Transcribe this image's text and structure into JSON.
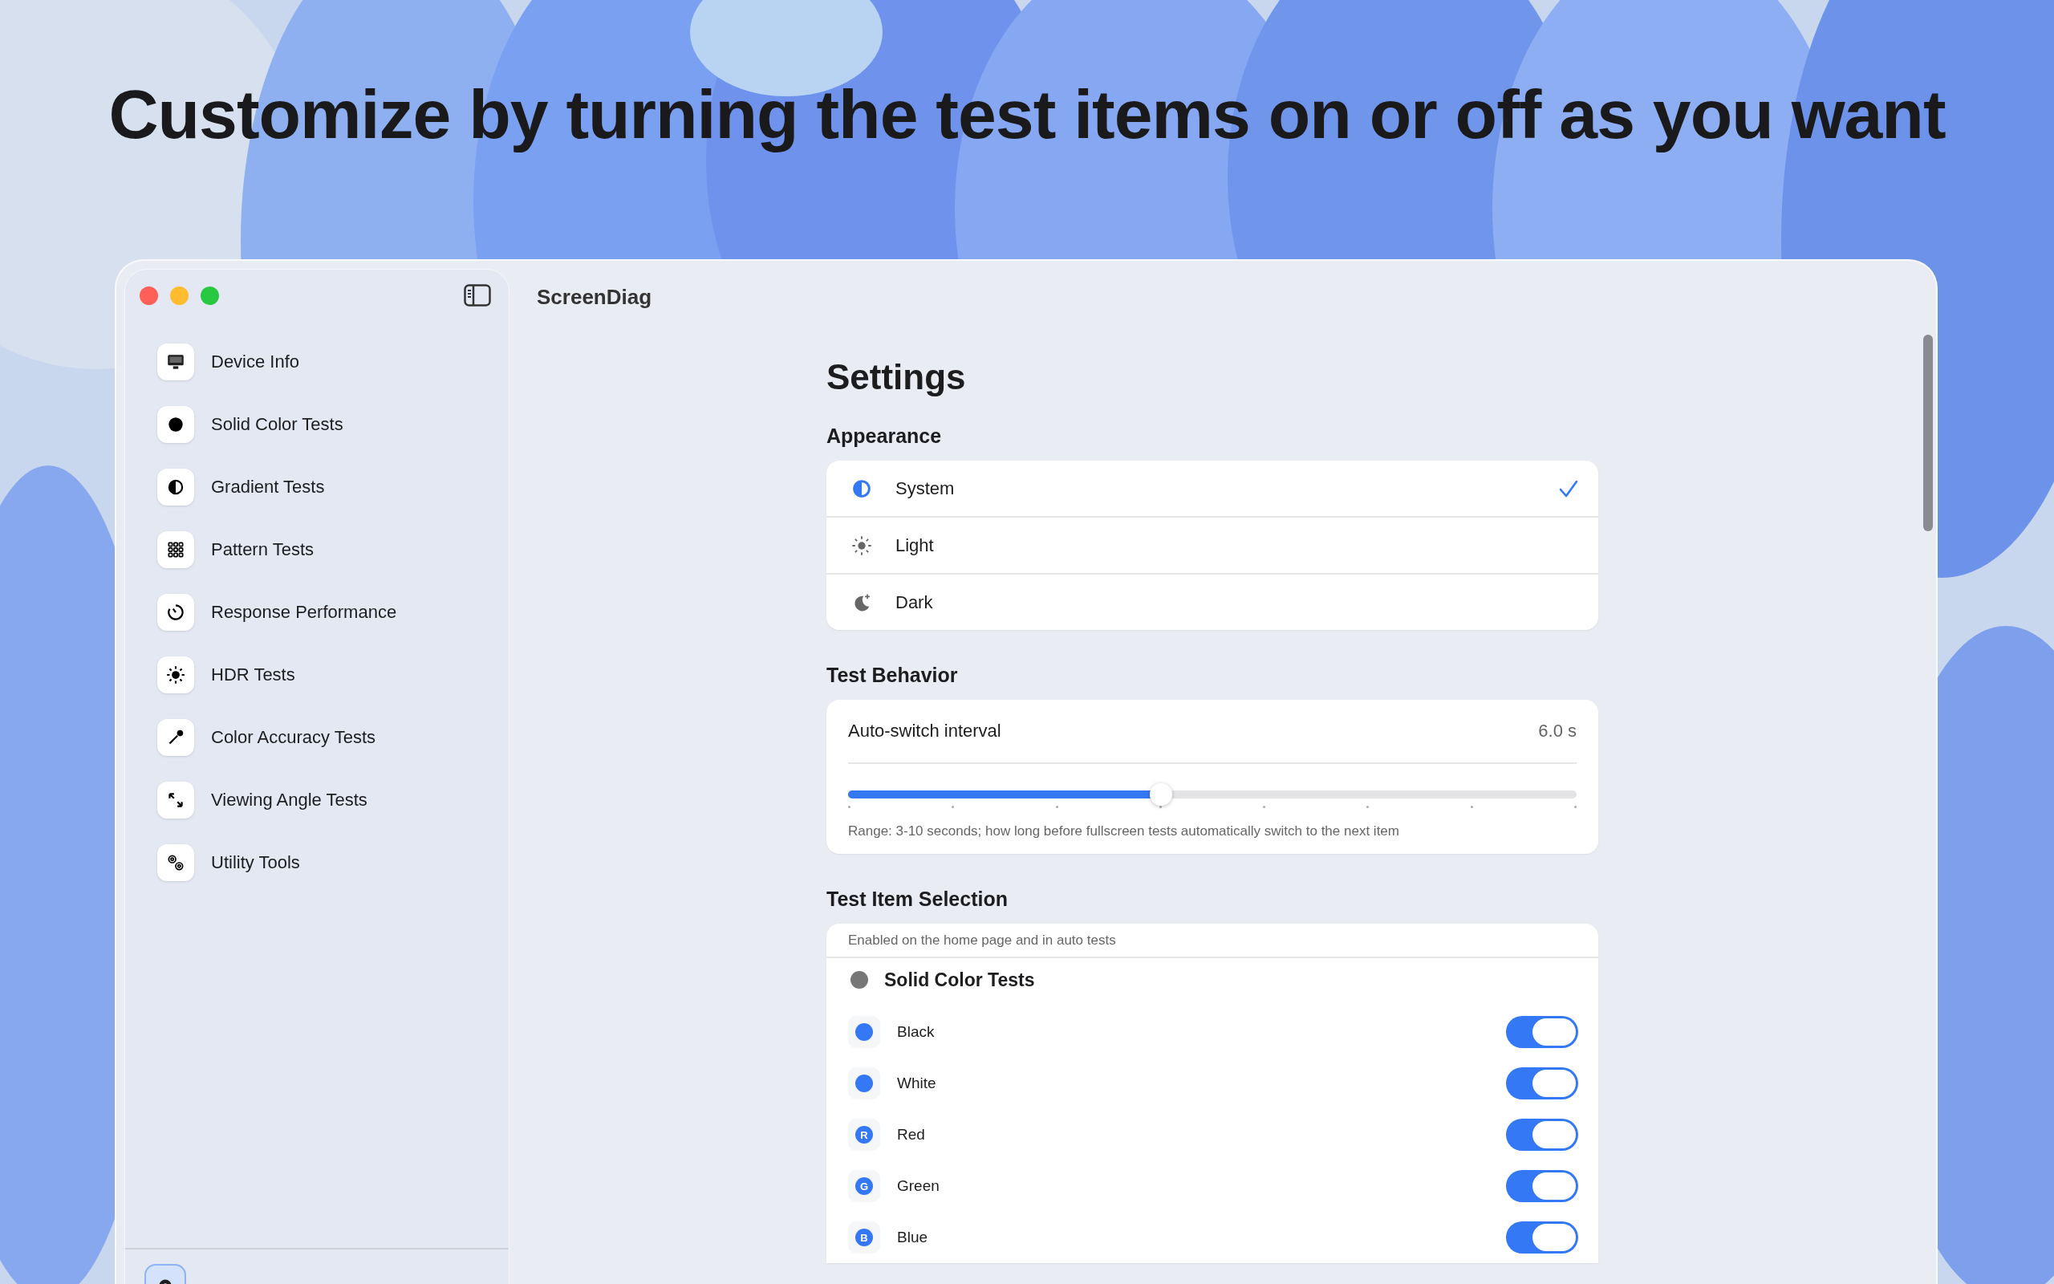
{
  "headline": "Customize by turning the test items on or off as you want",
  "window": {
    "title": "ScreenDiag"
  },
  "sidebar": {
    "items": [
      {
        "label": "Device Info",
        "selected": false
      },
      {
        "label": "Solid Color Tests",
        "selected": false
      },
      {
        "label": "Gradient Tests",
        "selected": false
      },
      {
        "label": "Pattern Tests",
        "selected": false
      },
      {
        "label": "Response Performance",
        "selected": false
      },
      {
        "label": "HDR Tests",
        "selected": false
      },
      {
        "label": "Color Accuracy Tests",
        "selected": false
      },
      {
        "label": "Viewing Angle Tests",
        "selected": false
      },
      {
        "label": "Utility Tools",
        "selected": false
      }
    ],
    "footer_item": {
      "selected": true
    }
  },
  "settings": {
    "title": "Settings",
    "appearance": {
      "heading": "Appearance",
      "options": [
        {
          "label": "System",
          "selected": true
        },
        {
          "label": "Light",
          "selected": false
        },
        {
          "label": "Dark",
          "selected": false
        }
      ]
    },
    "test_behavior": {
      "heading": "Test Behavior",
      "label": "Auto-switch interval",
      "reading": "6.0 s",
      "level": 0.43,
      "hint": "Range: 3-10 seconds; how long before fullscreen tests automatically switch to the next item"
    },
    "test_item_selection": {
      "heading": "Test Item Selection",
      "hint": "Enabled on the home page and in auto tests",
      "group": "Solid Color Tests",
      "items": [
        {
          "kind": "dot",
          "label": "Black",
          "on": true
        },
        {
          "kind": "dot",
          "label": "White",
          "on": true
        },
        {
          "kind": "letter",
          "badge": "R",
          "label": "Red",
          "on": true
        },
        {
          "kind": "letter",
          "badge": "G",
          "label": "Green",
          "on": true
        },
        {
          "kind": "letter",
          "badge": "B",
          "label": "Blue",
          "on": true
        }
      ]
    }
  }
}
